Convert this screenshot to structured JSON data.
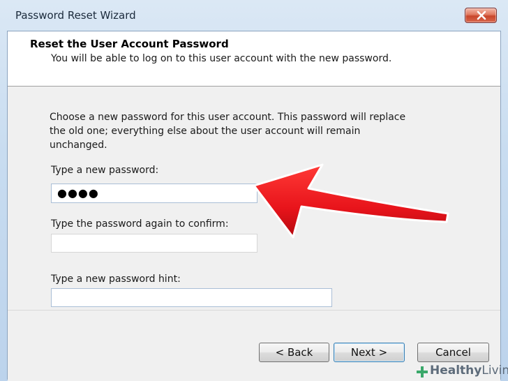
{
  "window": {
    "title": "Password Reset Wizard"
  },
  "header": {
    "title": "Reset the User Account Password",
    "subtitle": "You will be able to log on to this user account with the new password."
  },
  "content": {
    "description": "Choose a new password for this user account. This password will replace the old one; everything else about the user account will remain unchanged.",
    "new_password_label": "Type a new password:",
    "new_password_value": "●●●●",
    "confirm_label": "Type the password again to confirm:",
    "confirm_value": "",
    "hint_label": "Type a new password hint:",
    "hint_value": ""
  },
  "buttons": {
    "back": "< Back",
    "next": "Next >",
    "cancel": "Cancel"
  },
  "watermark": {
    "brand_bold": "Healthy",
    "brand_light": "Living"
  },
  "colors": {
    "arrow": "#e8141b",
    "close_button": "#d9684c",
    "default_button_border": "#3c7fb1"
  },
  "icons": {
    "close": "close-icon",
    "annotation": "red-arrow-icon",
    "brand": "plus-logo-icon"
  }
}
